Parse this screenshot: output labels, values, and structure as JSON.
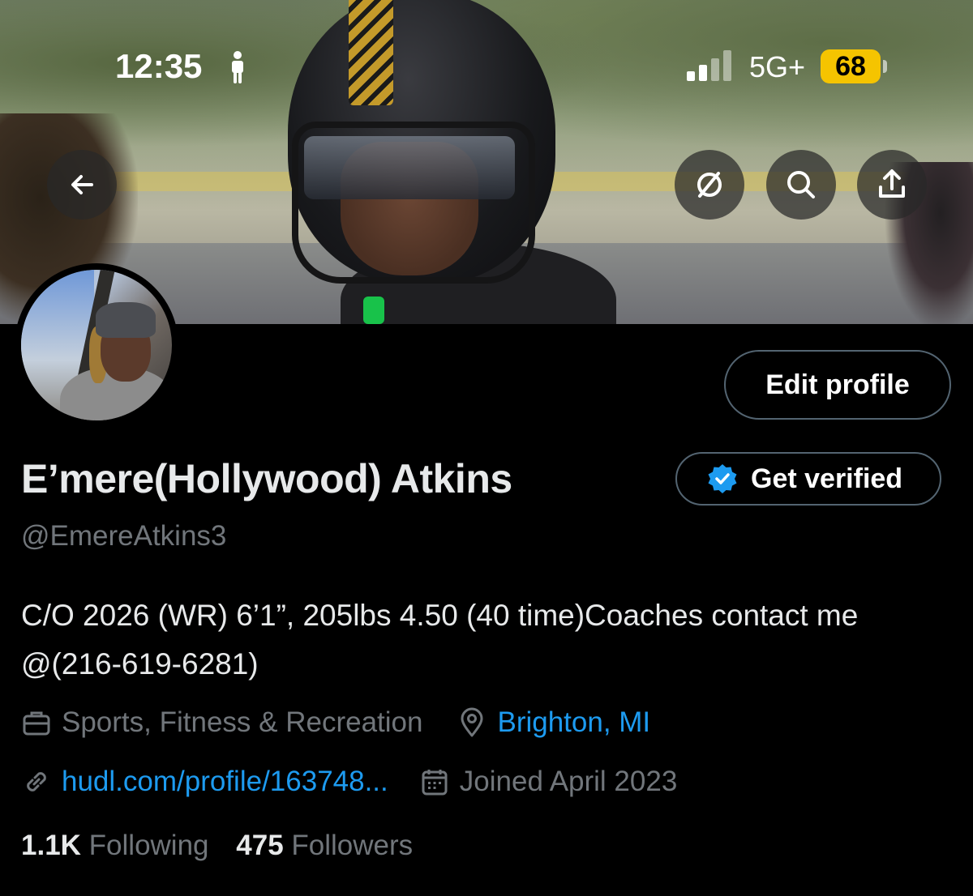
{
  "status_bar": {
    "time": "12:35",
    "network": "5G+",
    "battery": "68",
    "battery_color": "#f5c400"
  },
  "icons": {
    "back": "back-arrow-icon",
    "grok": "grok-icon",
    "search": "search-icon",
    "share": "share-icon"
  },
  "profile": {
    "edit_label": "Edit profile",
    "name": "E’mere(Hollywood) Atkins",
    "get_verified_label": "Get verified",
    "handle": "@EmereAtkins3",
    "bio": "C/O 2026 (WR) 6’1”, 205lbs 4.50 (40 time)Coaches contact me @(216-619-6281)",
    "category": "Sports, Fitness & Recreation",
    "location": "Brighton, MI",
    "website": "hudl.com/profile/163748...",
    "joined": "Joined April 2023",
    "following_count": "1.1K",
    "following_label": "Following",
    "followers_count": "475",
    "followers_label": "Followers"
  },
  "colors": {
    "link": "#1d9bf0",
    "muted": "#71767b",
    "border": "#536471",
    "verified": "#1d9bf0"
  }
}
